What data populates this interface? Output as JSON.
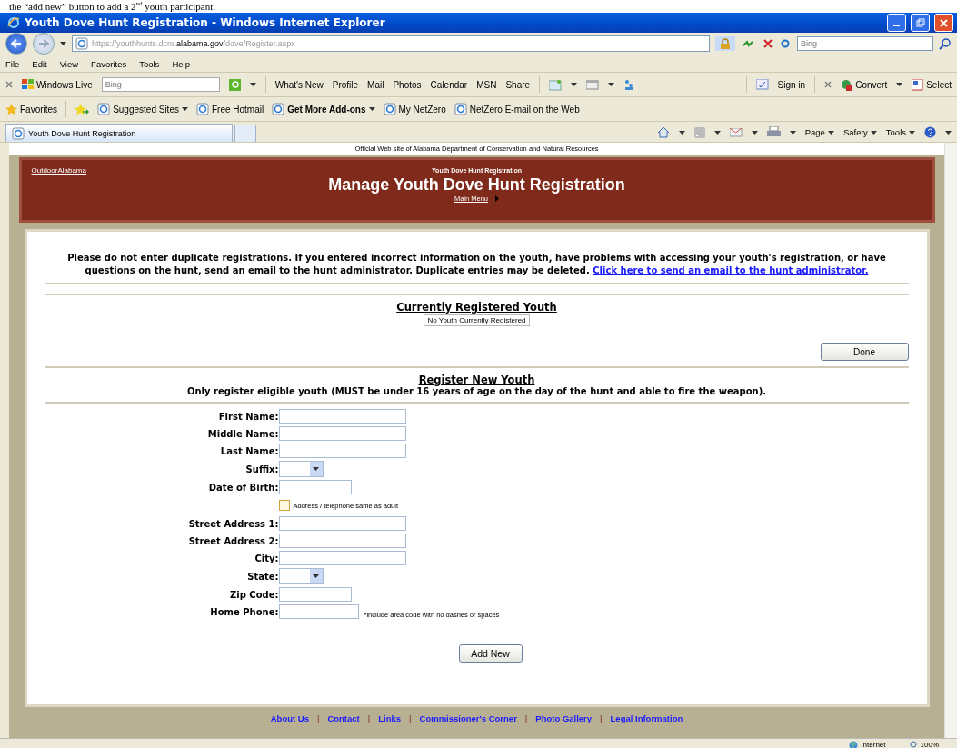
{
  "caption": "the “add new” button to add a 2$^{nd}$ youth participant.",
  "window": {
    "title": "Youth Dove Hunt Registration - Windows Internet Explorer"
  },
  "address_bar": {
    "url": "https://youthhunts.dcnr.**alabama.gov**/dove/Register.aspx",
    "search_placeholder": "Bing"
  },
  "menu": [
    "File",
    "Edit",
    "View",
    "Favorites",
    "Tools",
    "Help"
  ],
  "live_toolbar": {
    "brand": "Windows Live",
    "search_placeholder": "Bing",
    "links": [
      "What's New",
      "Profile",
      "Mail",
      "Photos",
      "Calendar",
      "MSN",
      "Share"
    ],
    "sign_in": "Sign in",
    "convert": "Convert",
    "select": "Select"
  },
  "favorites_bar": {
    "label": "Favorites",
    "items": [
      {
        "label": "Suggested Sites",
        "dropdown": true,
        "emphasized": false
      },
      {
        "label": "Free Hotmail",
        "dropdown": false,
        "emphasized": false
      },
      {
        "label": "Get More Add-ons",
        "dropdown": true,
        "emphasized": true
      },
      {
        "label": "My NetZero",
        "dropdown": false,
        "emphasized": false
      },
      {
        "label": "NetZero E-mail on the Web",
        "dropdown": false,
        "emphasized": false
      }
    ]
  },
  "tabs": [
    {
      "label": "Youth Dove Hunt Registration",
      "selected": true
    }
  ],
  "command_bar": [
    "Page",
    "Safety",
    "Tools"
  ],
  "page": {
    "top_notice": "Official Web site of Alabama Department of Conservation and Natural Resources",
    "home_link": "OutdoorAlabama",
    "subtitle": "Youth Dove Hunt Registration",
    "title": "Manage Youth Dove Hunt Registration",
    "main_menu": "Main Menu",
    "notice": "Please do not enter duplicate registrations. If you entered incorrect information on the youth, have problems with accessing your youth's registration, or have questions on the hunt, send an email to the hunt administrator. Duplicate entries may be deleted.",
    "notice_link": "Click here to send an email to the hunt administrator.",
    "registered_heading": "Currently Registered Youth",
    "registered_empty": "No Youth Currently Registered",
    "done_button": "Done",
    "register_heading": "Register New Youth",
    "register_note": "Only register eligible youth (MUST be under 16 years of age on the day of the hunt and able to fire the weapon).",
    "fields": [
      {
        "kind": "text",
        "label": "First Name:"
      },
      {
        "kind": "text",
        "label": "Middle Name:"
      },
      {
        "kind": "text",
        "label": "Last Name:"
      },
      {
        "kind": "select",
        "label": "Suffix:"
      },
      {
        "kind": "short",
        "label": "Date of Birth:"
      },
      {
        "kind": "checkbox",
        "label": "Address / telephone same as adult",
        "checked": false
      },
      {
        "kind": "text",
        "label": "Street Address 1:"
      },
      {
        "kind": "text",
        "label": "Street Address 2:"
      },
      {
        "kind": "text",
        "label": "City:"
      },
      {
        "kind": "select",
        "label": "State:"
      },
      {
        "kind": "short",
        "label": "Zip Code:"
      },
      {
        "kind": "phone",
        "label": "Home Phone:",
        "hint": "*include area code with no dashes or spaces"
      }
    ],
    "add_button": "Add New",
    "footer_links": [
      "About Us",
      "Contact",
      "Links",
      "Commissioner's Corner",
      "Photo Gallery",
      "Legal Information"
    ],
    "footer_separator": "|"
  },
  "status_bar": {
    "zone": "Internet",
    "zoom": "100%"
  }
}
